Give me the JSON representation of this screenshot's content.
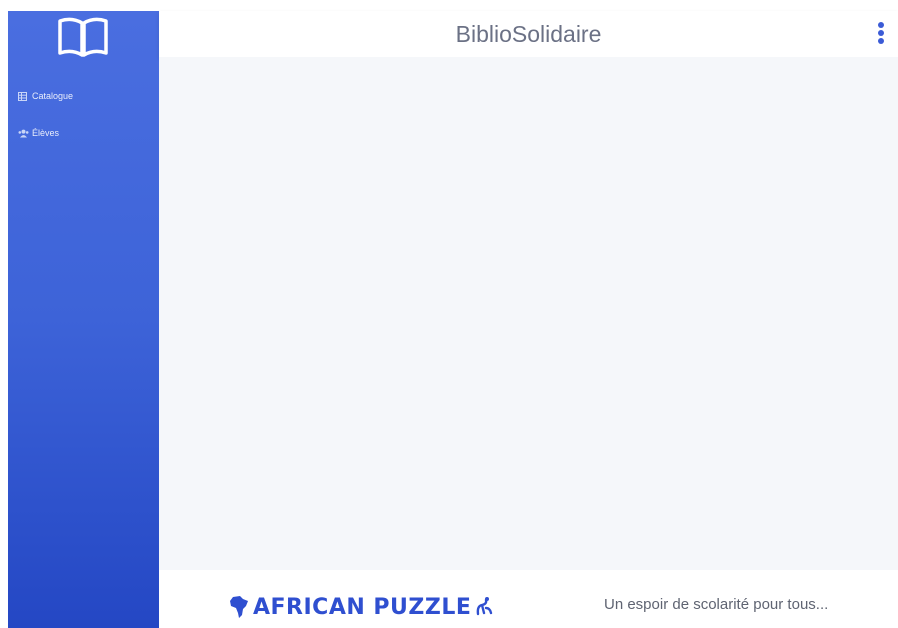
{
  "app": {
    "title": "BiblioSolidaire",
    "colors": {
      "sidebar_top": "#4a6ee0",
      "sidebar_bottom": "#2447c4",
      "accent": "#3b5bd6",
      "background": "#f5f7fa"
    }
  },
  "sidebar": {
    "logo_icon": "open-book-icon",
    "items": [
      {
        "label": "Catalogue",
        "icon": "table-icon"
      },
      {
        "label": "Élèves",
        "icon": "users-icon"
      }
    ]
  },
  "header": {
    "menu_icon": "kebab-menu-icon"
  },
  "footer": {
    "partner_logo_text": "AFRICAN PUZZLE",
    "tagline": "Un espoir de scolarité pour tous..."
  }
}
